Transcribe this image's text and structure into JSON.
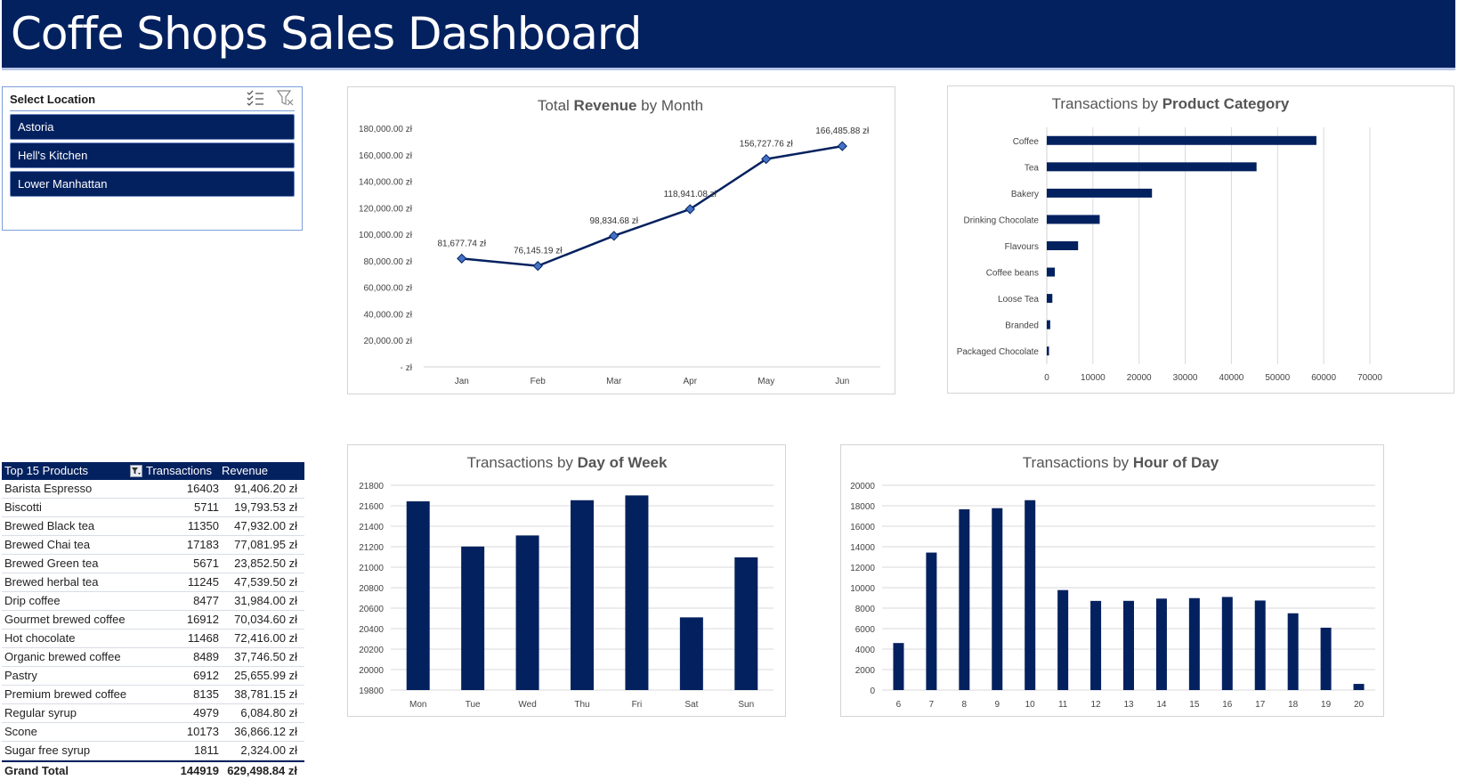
{
  "dashboard": {
    "title": "Coffe Shops Sales Dashboard"
  },
  "slicer": {
    "title": "Select Location",
    "items": [
      "Astoria",
      "Hell's Kitchen",
      "Lower Manhattan"
    ],
    "icons": [
      "multi-select-icon",
      "clear-filter-icon"
    ]
  },
  "table": {
    "headers": {
      "product": "Top 15 Products",
      "transactions": "Transactions",
      "revenue": "Revenue"
    },
    "rows": [
      {
        "product": "Barista Espresso",
        "transactions": "16403",
        "revenue": "91,406.20 zł"
      },
      {
        "product": "Biscotti",
        "transactions": "5711",
        "revenue": "19,793.53 zł"
      },
      {
        "product": "Brewed Black tea",
        "transactions": "11350",
        "revenue": "47,932.00 zł"
      },
      {
        "product": "Brewed Chai tea",
        "transactions": "17183",
        "revenue": "77,081.95 zł"
      },
      {
        "product": "Brewed Green tea",
        "transactions": "5671",
        "revenue": "23,852.50 zł"
      },
      {
        "product": "Brewed herbal tea",
        "transactions": "11245",
        "revenue": "47,539.50 zł"
      },
      {
        "product": "Drip coffee",
        "transactions": "8477",
        "revenue": "31,984.00 zł"
      },
      {
        "product": "Gourmet brewed coffee",
        "transactions": "16912",
        "revenue": "70,034.60 zł"
      },
      {
        "product": "Hot chocolate",
        "transactions": "11468",
        "revenue": "72,416.00 zł"
      },
      {
        "product": "Organic brewed coffee",
        "transactions": "8489",
        "revenue": "37,746.50 zł"
      },
      {
        "product": "Pastry",
        "transactions": "6912",
        "revenue": "25,655.99 zł"
      },
      {
        "product": "Premium brewed coffee",
        "transactions": "8135",
        "revenue": "38,781.15 zł"
      },
      {
        "product": "Regular syrup",
        "transactions": "4979",
        "revenue": "6,084.80 zł"
      },
      {
        "product": "Scone",
        "transactions": "10173",
        "revenue": "36,866.12 zł"
      },
      {
        "product": "Sugar free syrup",
        "transactions": "1811",
        "revenue": "2,324.00 zł"
      }
    ],
    "total": {
      "product": "Grand Total",
      "transactions": "144919",
      "revenue": "629,498.84 zł"
    }
  },
  "colors": {
    "primary": "#04215f",
    "banner_border": "#b7c6e6",
    "grid": "#d9d9d9",
    "marker": "#4472c4"
  },
  "chart_data": [
    {
      "id": "revenue-by-month",
      "type": "line",
      "title_parts": [
        "Total ",
        "Revenue",
        " by Month"
      ],
      "categories": [
        "Jan",
        "Feb",
        "Mar",
        "Apr",
        "May",
        "Jun"
      ],
      "values": [
        81677.74,
        76145.19,
        98834.68,
        118941.08,
        156727.76,
        166485.88
      ],
      "data_labels": [
        "81,677.74 zł",
        "76,145.19 zł",
        "98,834.68 zł",
        "118,941.08 zł",
        "156,727.76 zł",
        "166,485.88 zł"
      ],
      "ylim": [
        0,
        180000
      ],
      "y_ticks": [
        "-  zł",
        "20,000.00 zł",
        "40,000.00 zł",
        "60,000.00 zł",
        "80,000.00 zł",
        "100,000.00 zł",
        "120,000.00 zł",
        "140,000.00 zł",
        "160,000.00 zł",
        "180,000.00 zł"
      ],
      "grid": false
    },
    {
      "id": "transactions-by-category",
      "type": "bar",
      "orientation": "horizontal",
      "title_parts": [
        "Transactions by ",
        "Product Category",
        ""
      ],
      "categories": [
        "Coffee",
        "Tea",
        "Bakery",
        "Drinking Chocolate",
        "Flavours",
        "Coffee beans",
        "Loose Tea",
        "Branded",
        "Packaged Chocolate"
      ],
      "values": [
        58416,
        45449,
        22796,
        11468,
        6790,
        1753,
        1210,
        747,
        487
      ],
      "xlim": [
        0,
        70000
      ],
      "x_ticks": [
        "0",
        "10000",
        "20000",
        "30000",
        "40000",
        "50000",
        "60000",
        "70000"
      ],
      "grid": true
    },
    {
      "id": "transactions-by-day",
      "type": "bar",
      "title_parts": [
        "Transactions by ",
        "Day of Week",
        ""
      ],
      "categories": [
        "Mon",
        "Tue",
        "Wed",
        "Thu",
        "Fri",
        "Sat",
        "Sun"
      ],
      "values": [
        21643,
        21202,
        21310,
        21654,
        21701,
        20510,
        21096
      ],
      "ylim": [
        19800,
        21800
      ],
      "y_ticks": [
        "19800",
        "20000",
        "20200",
        "20400",
        "20600",
        "20800",
        "21000",
        "21200",
        "21400",
        "21600",
        "21800"
      ],
      "grid": true
    },
    {
      "id": "transactions-by-hour",
      "type": "bar",
      "title_parts": [
        "Transactions by ",
        "Hour of Day",
        ""
      ],
      "categories": [
        "6",
        "7",
        "8",
        "9",
        "10",
        "11",
        "12",
        "13",
        "14",
        "15",
        "16",
        "17",
        "18",
        "19",
        "20"
      ],
      "values": [
        4594,
        13428,
        17654,
        17764,
        18545,
        9766,
        8708,
        8714,
        8933,
        8979,
        9093,
        8745,
        7498,
        6092,
        603
      ],
      "ylim": [
        0,
        20000
      ],
      "y_ticks": [
        "0",
        "2000",
        "4000",
        "6000",
        "8000",
        "10000",
        "12000",
        "14000",
        "16000",
        "18000",
        "20000"
      ],
      "grid": true
    }
  ]
}
